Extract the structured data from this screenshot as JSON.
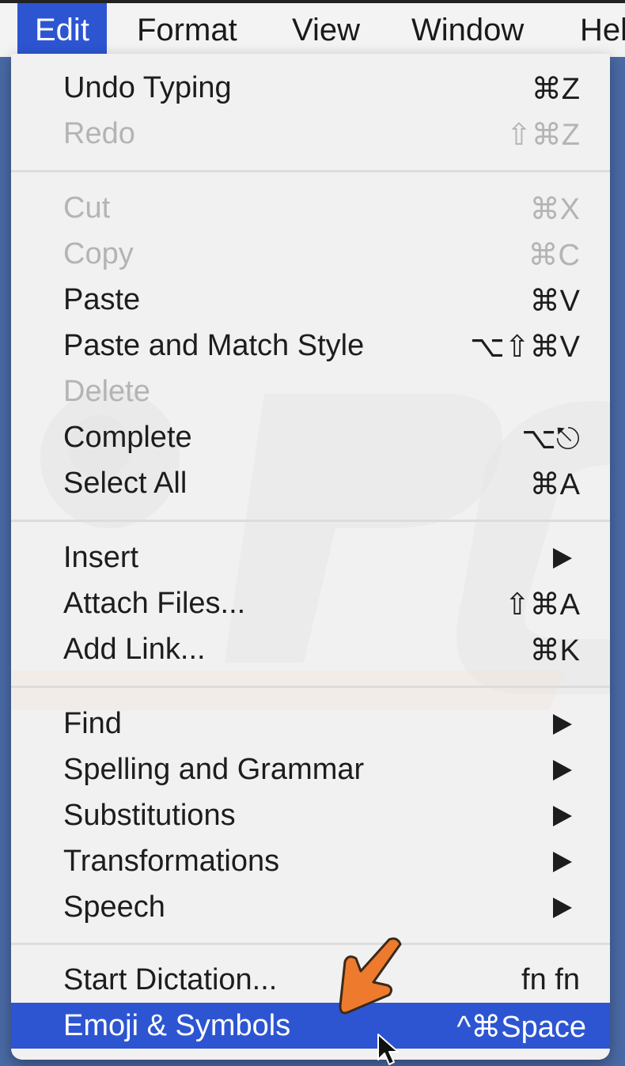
{
  "menubar": {
    "items": [
      "Edit",
      "Format",
      "View",
      "Window",
      "Help"
    ]
  },
  "menu": {
    "undo_typing": {
      "label": "Undo Typing",
      "shortcut": "⌘Z"
    },
    "redo": {
      "label": "Redo",
      "shortcut": "⇧⌘Z"
    },
    "cut": {
      "label": "Cut",
      "shortcut": "⌘X"
    },
    "copy": {
      "label": "Copy",
      "shortcut": "⌘C"
    },
    "paste": {
      "label": "Paste",
      "shortcut": "⌘V"
    },
    "paste_match": {
      "label": "Paste and Match Style",
      "shortcut": "⌥⇧⌘V"
    },
    "delete": {
      "label": "Delete"
    },
    "complete": {
      "label": "Complete",
      "shortcut": "⌥⎋"
    },
    "select_all": {
      "label": "Select All",
      "shortcut": "⌘A"
    },
    "insert": {
      "label": "Insert"
    },
    "attach_files": {
      "label": "Attach Files...",
      "shortcut": "⇧⌘A"
    },
    "add_link": {
      "label": "Add Link...",
      "shortcut": "⌘K"
    },
    "find": {
      "label": "Find"
    },
    "spelling": {
      "label": "Spelling and Grammar"
    },
    "substitutions": {
      "label": "Substitutions"
    },
    "transformations": {
      "label": "Transformations"
    },
    "speech": {
      "label": "Speech"
    },
    "dictation": {
      "label": "Start Dictation...",
      "shortcut": "fn fn"
    },
    "emoji": {
      "label": "Emoji & Symbols",
      "shortcut": "^⌘Space"
    }
  },
  "colors": {
    "highlight": "#2d55d2",
    "menu_bg": "#f1f1f1",
    "annotation_arrow": "#ee7a2e"
  }
}
